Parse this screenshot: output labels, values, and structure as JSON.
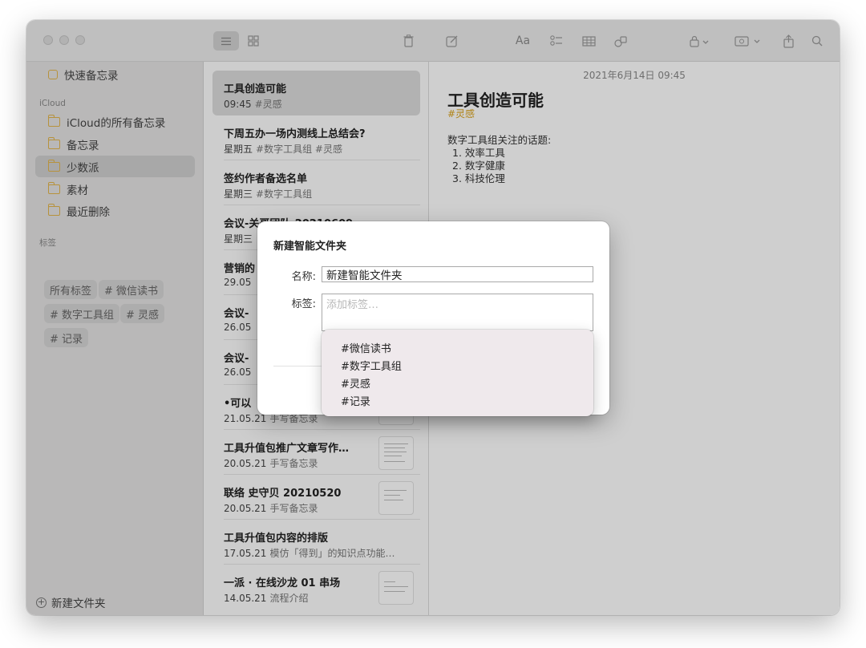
{
  "sidebar": {
    "quick_notes": "快速备忘录",
    "icloud_header": "iCloud",
    "folders": [
      "iCloud的所有备忘录",
      "备忘录",
      "少数派",
      "素材",
      "最近删除"
    ],
    "selected_folder": "少数派",
    "tags_header": "标签",
    "tags": [
      "所有标签",
      "# 微信读书",
      "# 数字工具组",
      "# 灵感",
      "# 记录"
    ],
    "new_folder": "新建文件夹"
  },
  "notes": [
    {
      "title": "工具创造可能",
      "date": "09:45",
      "sub": "#灵感"
    },
    {
      "title": "下周五办一场内测线上总结会?",
      "date": "星期五",
      "sub": "#数字工具组 #灵感"
    },
    {
      "title": "签约作者备选名单",
      "date": "星期三",
      "sub": "#数字工具组"
    },
    {
      "title": "会议-关哥团队-20210609",
      "date": "星期三",
      "sub": ""
    },
    {
      "title": "营销的",
      "date": "29.05",
      "sub": ""
    },
    {
      "title": "会议-",
      "date": "26.05",
      "sub": ""
    },
    {
      "title": "会议-",
      "date": "26.05",
      "sub": ""
    },
    {
      "title": "•可以",
      "date": "21.05.21",
      "sub": "手写备忘录"
    },
    {
      "title": "工具升值包推广文章写作…",
      "date": "20.05.21",
      "sub": "手写备忘录"
    },
    {
      "title": "联络 史守贝 20210520",
      "date": "20.05.21",
      "sub": "手写备忘录"
    },
    {
      "title": "工具升值包内容的排版",
      "date": "17.05.21",
      "sub": "模仿「得到」的知识点功能…"
    },
    {
      "title": "一派 · 在线沙龙 01 串场",
      "date": "14.05.21",
      "sub": "流程介绍"
    }
  ],
  "editor": {
    "date": "2021年6月14日 09:45",
    "title": "工具创造可能",
    "tag": "#灵感",
    "body_intro": "数字工具组关注的话题:",
    "list": [
      "1. 效率工具",
      "2. 数字健康",
      "3. 科技伦理"
    ]
  },
  "dialog": {
    "title": "新建智能文件夹",
    "name_label": "名称:",
    "name_value": "新建智能文件夹",
    "tags_label": "标签:",
    "tags_placeholder": "添加标签…"
  },
  "suggestions": [
    "#微信读书",
    "#数字工具组",
    "#灵感",
    "#记录"
  ],
  "colors": {
    "accent": "#e2b44a",
    "tag": "#d9a21b"
  }
}
